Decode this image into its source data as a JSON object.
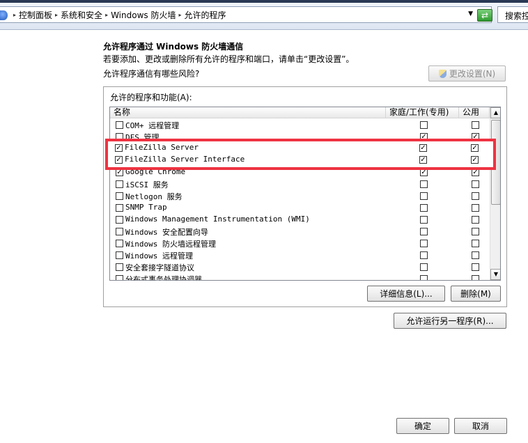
{
  "address_bar": {
    "breadcrumbs": [
      "控制面板",
      "系统和安全",
      "Windows 防火墙",
      "允许的程序"
    ],
    "search_placeholder": "搜索控"
  },
  "header": {
    "title": "允许程序通过 Windows 防火墙通信",
    "subtitle": "若要添加、更改或删除所有允许的程序和端口，请单击“更改设置”。",
    "risk_link": "允许程序通信有哪些风险?",
    "change_settings_label": "更改设置(N)"
  },
  "list": {
    "caption": "允许的程序和功能(A):",
    "columns": {
      "name": "名称",
      "home": "家庭/工作(专用)",
      "public": "公用"
    },
    "rows": [
      {
        "name": "COM+ 远程管理",
        "enabled": false,
        "home": false,
        "public": false
      },
      {
        "name": "DFS 管理",
        "enabled": false,
        "home": true,
        "public": true
      },
      {
        "name": "FileZilla Server",
        "enabled": true,
        "home": true,
        "public": true
      },
      {
        "name": "FileZilla Server Interface",
        "enabled": true,
        "home": true,
        "public": true
      },
      {
        "name": "Google Chrome",
        "enabled": true,
        "home": true,
        "public": true
      },
      {
        "name": "iSCSI 服务",
        "enabled": false,
        "home": false,
        "public": false
      },
      {
        "name": "Netlogon 服务",
        "enabled": false,
        "home": false,
        "public": false
      },
      {
        "name": "SNMP Trap",
        "enabled": false,
        "home": false,
        "public": false
      },
      {
        "name": "Windows Management Instrumentation (WMI)",
        "enabled": false,
        "home": false,
        "public": false
      },
      {
        "name": "Windows 安全配置向导",
        "enabled": false,
        "home": false,
        "public": false
      },
      {
        "name": "Windows 防火墙远程管理",
        "enabled": false,
        "home": false,
        "public": false
      },
      {
        "name": "Windows 远程管理",
        "enabled": false,
        "home": false,
        "public": false
      },
      {
        "name": "安全套接字隧道协议",
        "enabled": false,
        "home": false,
        "public": false
      },
      {
        "name": "分布式事务处理协调器",
        "enabled": false,
        "home": false,
        "public": false
      }
    ]
  },
  "buttons": {
    "details": "详细信息(L)...",
    "delete": "删除(M)",
    "allow_another": "允许运行另一程序(R)...",
    "ok": "确定",
    "cancel": "取消"
  },
  "highlight": {
    "color": "#ee3341",
    "rows": [
      {
        "name": "FileZilla Server",
        "enabled": true,
        "home": true,
        "public": true
      },
      {
        "name": "FileZilla Server Interface",
        "enabled": true,
        "home": true,
        "public": true
      }
    ]
  }
}
